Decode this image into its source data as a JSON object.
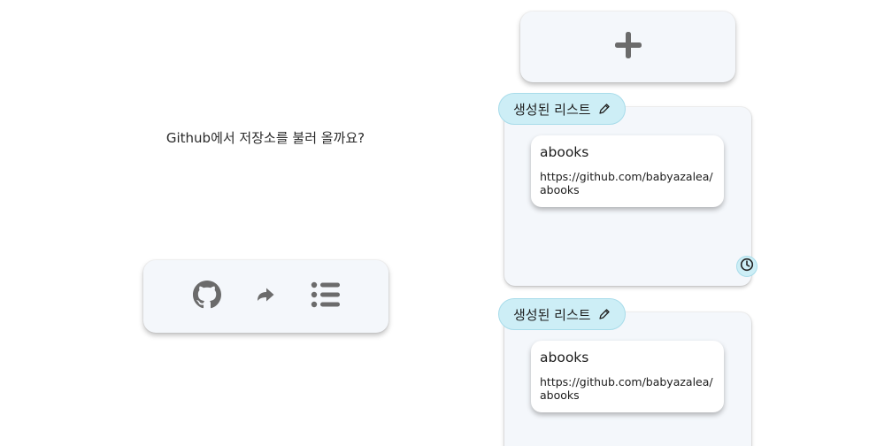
{
  "prompt": {
    "text": "Github에서 저장소를 불러 올까요?"
  },
  "action_bar": {
    "buttons": [
      {
        "icon": "github-icon"
      },
      {
        "icon": "redo-arrow-icon"
      },
      {
        "icon": "list-icon"
      }
    ]
  },
  "add_button": {
    "icon": "plus-icon"
  },
  "lists": [
    {
      "title": "생성된 리스트",
      "edit_icon": "pencil-icon",
      "repos": [
        {
          "name": "abooks",
          "url": "https://github.com/babyazalea/abooks"
        }
      ],
      "history_icon": "clock-icon"
    },
    {
      "title": "생성된 리스트",
      "edit_icon": "pencil-icon",
      "repos": [
        {
          "name": "abooks",
          "url": "https://github.com/babyazalea/abooks"
        }
      ]
    }
  ],
  "colors": {
    "panel_bg": "#f4f7fb",
    "tag_bg": "#cdeef6",
    "icon_gray": "#6b6b6b"
  }
}
